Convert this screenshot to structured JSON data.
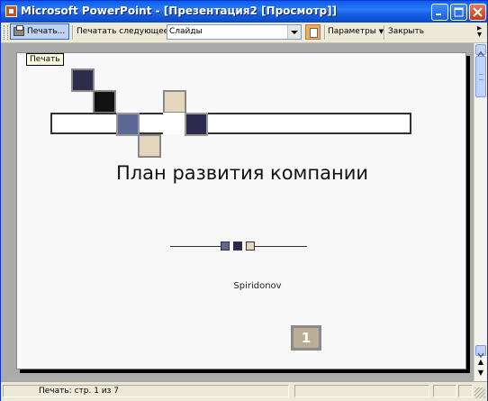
{
  "window": {
    "title": "Microsoft PowerPoint - [Презентация2 [Просмотр]]"
  },
  "toolbar": {
    "print_label": "Печать...",
    "print_next_label": "Печатать следующее:",
    "print_what_value": "Слайды",
    "options_label": "Параметры",
    "close_label": "Закрыть"
  },
  "tooltip": "Печать",
  "slide": {
    "title": "План развития компании",
    "author": "Spiridonov",
    "page_number": "1"
  },
  "status": {
    "text": "Печать: стр. 1 из 7"
  },
  "colors": {
    "titlebar": "#0a5de8",
    "dark_navy": "#2d2c4a",
    "black": "#111111",
    "slate_blue": "#5c6895",
    "beige": "#e4d7bd",
    "navy": "#2c2a4e",
    "page_badge": "#bcae96"
  },
  "icons": [
    "app-icon",
    "minimize-icon",
    "maximize-icon",
    "close-icon",
    "printer-icon",
    "orientation-icon",
    "scroll-up-icon",
    "scroll-down-icon",
    "prev-page-icon",
    "next-page-icon"
  ]
}
